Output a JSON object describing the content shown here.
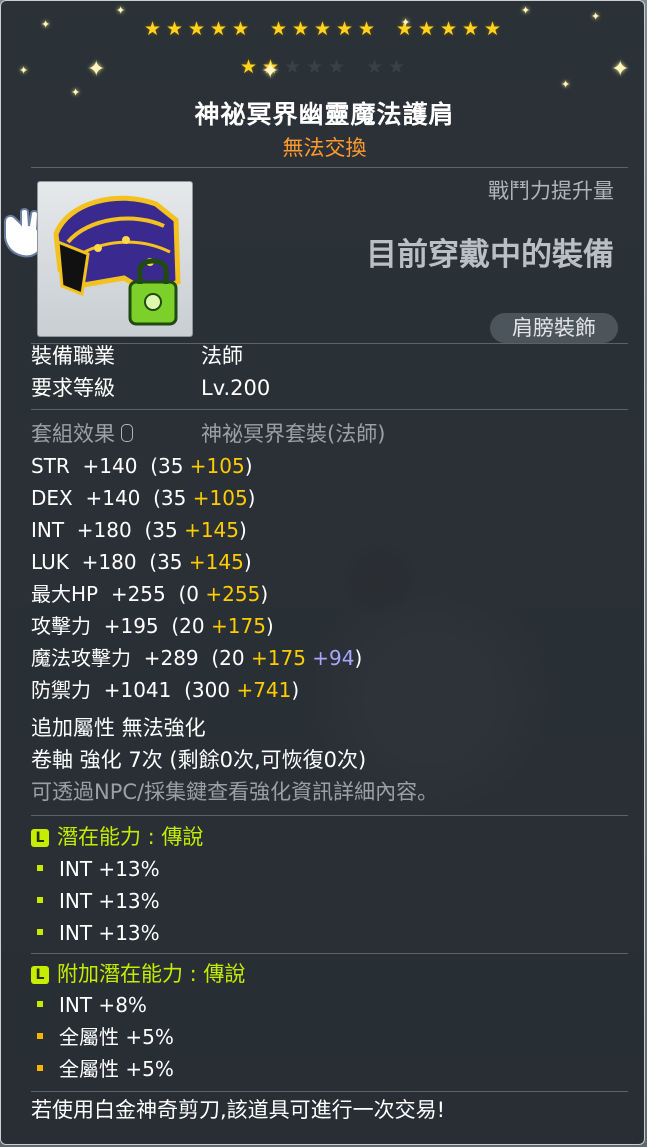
{
  "stars": {
    "filled": 17,
    "total": 22
  },
  "item": {
    "name": "神祕冥界幽靈魔法護肩",
    "trade_status": "無法交換",
    "combat_power_label": "戰鬥力提升量",
    "equipped_text": "目前穿戴中的裝備",
    "type": "肩膀裝飾"
  },
  "requirements": {
    "job_label": "裝備職業",
    "job_value": "法師",
    "level_label": "要求等級",
    "level_value": "Lv.200"
  },
  "set": {
    "label": "套組效果",
    "value": "神祕冥界套裝(法師)"
  },
  "stats": [
    {
      "name": "STR",
      "total": "+140",
      "base": "(35",
      "bonus": "+105",
      "extra": "",
      "close": ")"
    },
    {
      "name": "DEX",
      "total": "+140",
      "base": "(35",
      "bonus": "+105",
      "extra": "",
      "close": ")"
    },
    {
      "name": "INT",
      "total": "+180",
      "base": "(35",
      "bonus": "+145",
      "extra": "",
      "close": ")"
    },
    {
      "name": "LUK",
      "total": "+180",
      "base": "(35",
      "bonus": "+145",
      "extra": "",
      "close": ")"
    },
    {
      "name": "最大HP",
      "total": "+255",
      "base": "(0",
      "bonus": "+255",
      "extra": "",
      "close": ")"
    },
    {
      "name": "攻擊力",
      "total": "+195",
      "base": "(20",
      "bonus": "+175",
      "extra": "",
      "close": ")"
    },
    {
      "name": "魔法攻擊力",
      "total": "+289",
      "base": "(20",
      "bonus": "+175",
      "extra": "+94",
      "close": ")"
    },
    {
      "name": "防禦力",
      "total": "+1041",
      "base": "(300",
      "bonus": "+741",
      "extra": "",
      "close": ")"
    }
  ],
  "upgrade": {
    "extra_attr": "追加屬性 無法強化",
    "scroll": "卷軸 強化 7次 (剩餘0次,可恢復0次)",
    "npc_note": "可透過NPC/採集鍵查看強化資訊詳細內容。"
  },
  "potential": {
    "badge": "L",
    "title": "潛在能力 : 傳說",
    "lines": [
      "INT +13%",
      "INT +13%",
      "INT +13%"
    ]
  },
  "additional_potential": {
    "badge": "L",
    "title": "附加潛在能力 : 傳說",
    "lines": [
      "INT +8%",
      "全屬性 +5%",
      "全屬性 +5%"
    ]
  },
  "footer_note": "若使用白金神奇剪刀,該道具可進行一次交易!",
  "colors": {
    "gold": "#ffcc00",
    "purple": "#a7a7ff",
    "legendary_green": "#c6ec00",
    "orange": "#ff9a2e"
  }
}
